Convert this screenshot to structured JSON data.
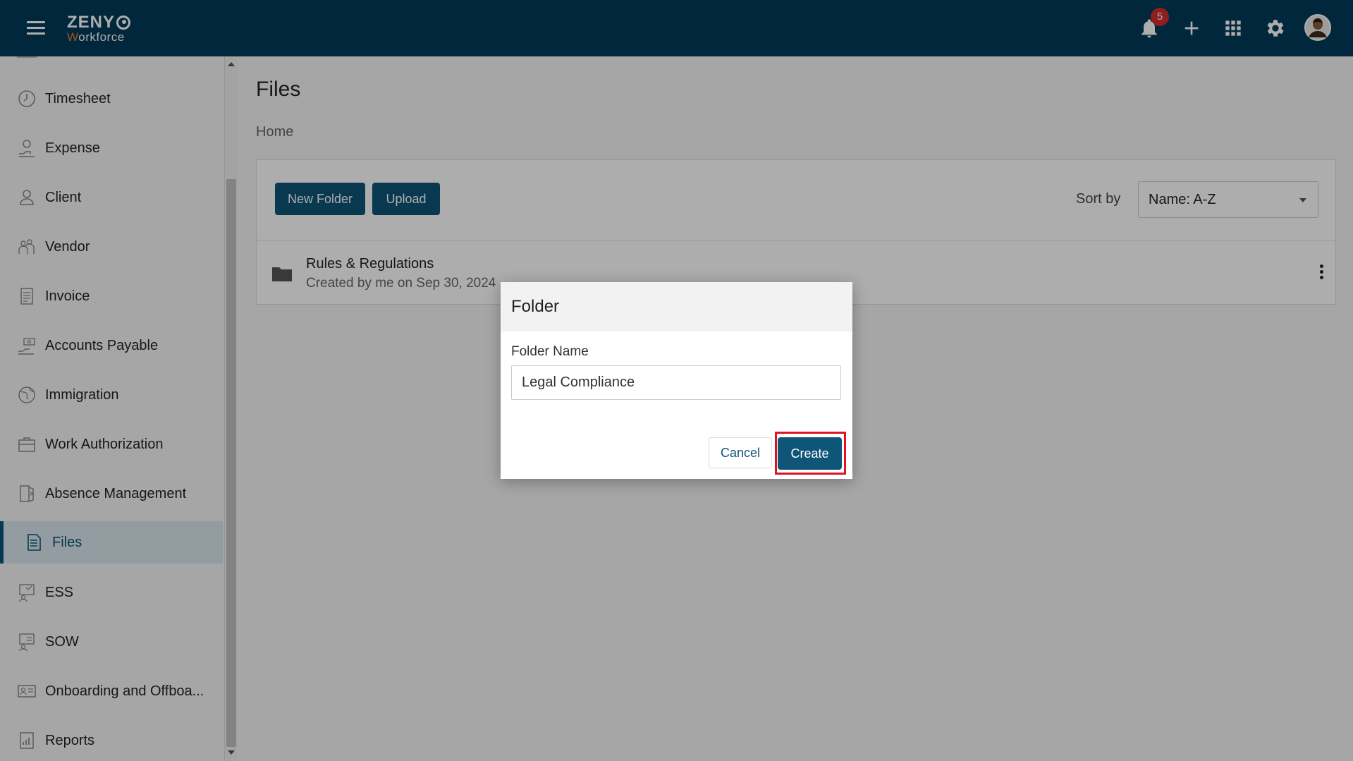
{
  "header": {
    "logo_top": "ZENY",
    "logo_bottom_first": "W",
    "logo_bottom_rest": "orkforce",
    "notification_count": "5",
    "icons": [
      "menu-icon",
      "bell-icon",
      "plus-icon",
      "apps-grid-icon",
      "gear-icon",
      "avatar"
    ]
  },
  "sidebar": {
    "items": [
      {
        "label": "Timesheet",
        "icon": "clock-icon"
      },
      {
        "label": "Expense",
        "icon": "expense-icon"
      },
      {
        "label": "Client",
        "icon": "person-icon"
      },
      {
        "label": "Vendor",
        "icon": "vendor-icon"
      },
      {
        "label": "Invoice",
        "icon": "invoice-icon"
      },
      {
        "label": "Accounts Payable",
        "icon": "accounts-payable-icon"
      },
      {
        "label": "Immigration",
        "icon": "globe-icon"
      },
      {
        "label": "Work Authorization",
        "icon": "briefcase-icon"
      },
      {
        "label": "Absence Management",
        "icon": "door-icon"
      },
      {
        "label": "Files",
        "icon": "file-icon",
        "active": true
      },
      {
        "label": "ESS",
        "icon": "ess-icon"
      },
      {
        "label": "SOW",
        "icon": "sow-icon"
      },
      {
        "label": "Onboarding and Offboa...",
        "icon": "id-card-icon"
      },
      {
        "label": "Reports",
        "icon": "report-icon"
      }
    ]
  },
  "main": {
    "title": "Files",
    "breadcrumb": "Home",
    "new_folder_label": "New Folder",
    "upload_label": "Upload",
    "sort_label": "Sort by",
    "sort_value": "Name: A-Z",
    "files": [
      {
        "name": "Rules & Regulations",
        "meta": "Created by me on Sep 30, 2024"
      }
    ]
  },
  "dialog": {
    "title": "Folder",
    "field_label": "Folder Name",
    "field_value": "Legal Compliance",
    "cancel_label": "Cancel",
    "create_label": "Create"
  },
  "colors": {
    "header_bg": "#003a57",
    "primary": "#0e5577",
    "logo_accent": "#e27a2c",
    "badge": "#d32f2f",
    "highlight": "#e0141e"
  }
}
